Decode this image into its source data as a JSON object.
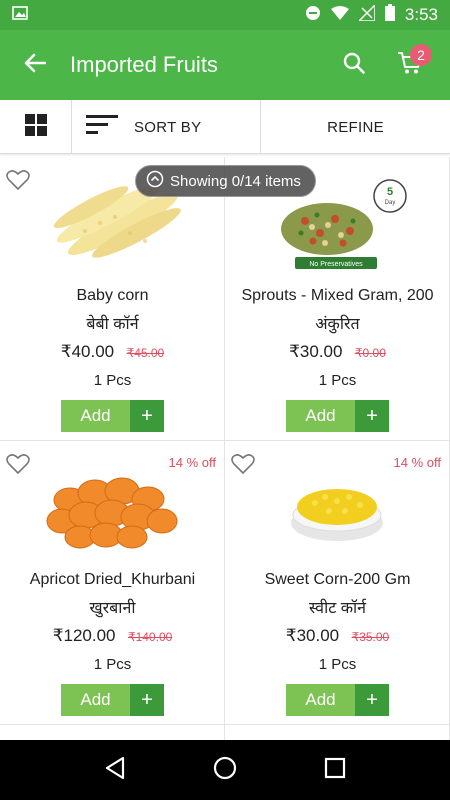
{
  "status": {
    "time": "3:53"
  },
  "appbar": {
    "title": "Imported Fruits",
    "cart_count": "2"
  },
  "toolbar": {
    "sort_label": "SORT BY",
    "refine_label": "REFINE"
  },
  "showing_pill": "Showing 0/14 items",
  "products": [
    {
      "name": "Baby corn",
      "hindi": "बेबी कॉर्न",
      "price": "₹40.00",
      "mrp": "₹45.00",
      "qty": "1 Pcs",
      "discount": "",
      "add": "Add"
    },
    {
      "name": "Sprouts - Mixed Gram, 200",
      "hindi": "अंकुरित",
      "price": "₹30.00",
      "mrp": "₹0.00",
      "qty": "1 Pcs",
      "discount": "",
      "add": "Add"
    },
    {
      "name": "Apricot Dried_Khurbani",
      "hindi": "खुरबानी",
      "price": "₹120.00",
      "mrp": "₹140.00",
      "qty": "1 Pcs",
      "discount": "14 % off",
      "add": "Add"
    },
    {
      "name": "Sweet Corn-200 Gm",
      "hindi": "स्वीट कॉर्न",
      "price": "₹30.00",
      "mrp": "₹35.00",
      "qty": "1 Pcs",
      "discount": "14 % off",
      "add": "Add"
    }
  ],
  "colors": {
    "appbar": "#4cb748",
    "statusbar": "#43a940",
    "add_button": "#7cc354",
    "plus_button": "#3d9a3b",
    "discount": "#e04d5f"
  },
  "icons": [
    "image-icon",
    "dnd-icon",
    "wifi-icon",
    "signal-icon",
    "battery-icon",
    "back-arrow-icon",
    "search-icon",
    "cart-icon",
    "grid-view-icon",
    "sort-icon",
    "heart-icon",
    "chevron-up-icon",
    "nav-back-icon",
    "nav-home-icon",
    "nav-recents-icon"
  ]
}
